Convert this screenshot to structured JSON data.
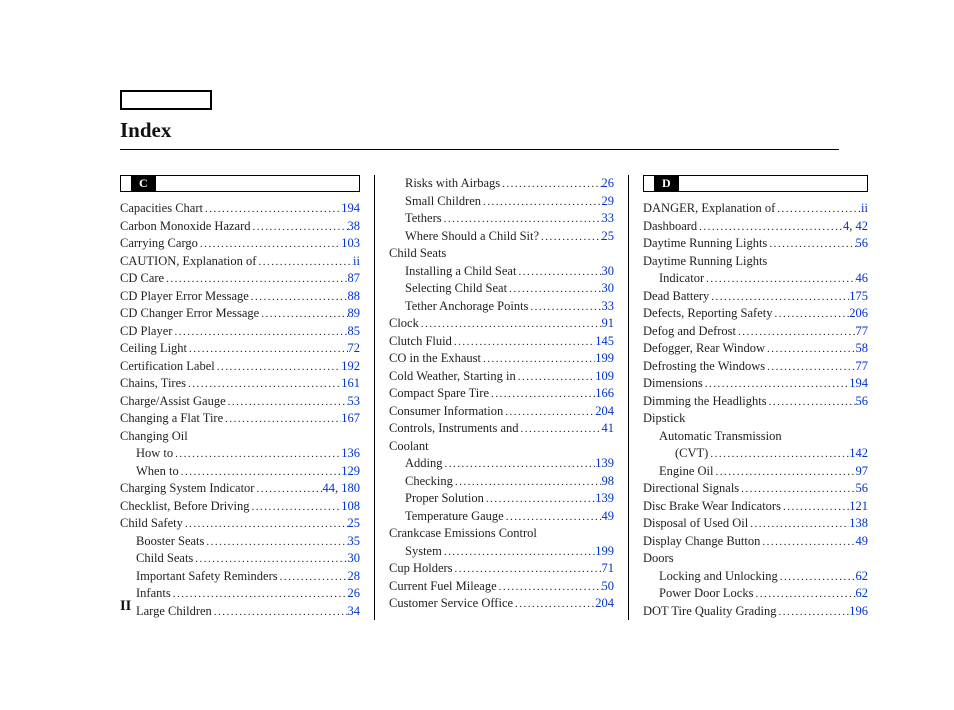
{
  "title": "Index",
  "page_number": "II",
  "sections": {
    "C": {
      "letter": "C"
    },
    "D": {
      "letter": "D"
    }
  },
  "col1": [
    {
      "type": "section",
      "letter": "C"
    },
    {
      "label": "Capacities Chart",
      "pages": [
        "194"
      ],
      "indent": 0
    },
    {
      "label": "Carbon Monoxide Hazard",
      "pages": [
        "38"
      ],
      "indent": 0
    },
    {
      "label": "Carrying Cargo",
      "pages": [
        "103"
      ],
      "indent": 0
    },
    {
      "label": "CAUTION, Explanation of",
      "pages": [
        "ii"
      ],
      "indent": 0
    },
    {
      "label": "CD Care",
      "pages": [
        "87"
      ],
      "indent": 0
    },
    {
      "label": "CD Player Error Message",
      "pages": [
        "88"
      ],
      "indent": 0
    },
    {
      "label": "CD Changer Error Message",
      "pages": [
        "89"
      ],
      "indent": 0
    },
    {
      "label": "CD Player",
      "pages": [
        "85"
      ],
      "indent": 0
    },
    {
      "label": "Ceiling Light",
      "pages": [
        "72"
      ],
      "indent": 0
    },
    {
      "label": "Certification Label",
      "pages": [
        "192"
      ],
      "indent": 0
    },
    {
      "label": "Chains, Tires",
      "pages": [
        "161"
      ],
      "indent": 0
    },
    {
      "label": "Charge/Assist Gauge",
      "pages": [
        "53"
      ],
      "indent": 0
    },
    {
      "label": "Changing a Flat Tire",
      "pages": [
        "167"
      ],
      "indent": 0
    },
    {
      "label": "Changing Oil",
      "plain": true,
      "indent": 0
    },
    {
      "label": "How to",
      "pages": [
        "136"
      ],
      "indent": 1
    },
    {
      "label": "When to",
      "pages": [
        "129"
      ],
      "indent": 1
    },
    {
      "label": "Charging System Indicator",
      "pages": [
        "44",
        "180"
      ],
      "indent": 0
    },
    {
      "label": "Checklist, Before Driving",
      "pages": [
        "108"
      ],
      "indent": 0
    },
    {
      "label": "Child Safety",
      "pages": [
        "25"
      ],
      "indent": 0
    },
    {
      "label": "Booster Seats",
      "pages": [
        "35"
      ],
      "indent": 1
    },
    {
      "label": "Child Seats",
      "pages": [
        "30"
      ],
      "indent": 1
    },
    {
      "label": "Important Safety Reminders",
      "pages": [
        "28"
      ],
      "indent": 1
    },
    {
      "label": "Infants",
      "pages": [
        "26"
      ],
      "indent": 1
    },
    {
      "label": "Large Children",
      "pages": [
        "34"
      ],
      "indent": 1
    }
  ],
  "col2": [
    {
      "label": "Risks with Airbags",
      "pages": [
        "26"
      ],
      "indent": 1,
      "topspace": true
    },
    {
      "label": "Small Children",
      "pages": [
        "29"
      ],
      "indent": 1
    },
    {
      "label": "Tethers",
      "pages": [
        "33"
      ],
      "indent": 1
    },
    {
      "label": "Where Should a Child Sit?",
      "pages": [
        "25"
      ],
      "indent": 1
    },
    {
      "label": "Child Seats",
      "plain": true,
      "indent": 0
    },
    {
      "label": "Installing a Child Seat",
      "pages": [
        "30"
      ],
      "indent": 1
    },
    {
      "label": "Selecting Child Seat",
      "pages": [
        "30"
      ],
      "indent": 1
    },
    {
      "label": "Tether Anchorage Points",
      "pages": [
        "33"
      ],
      "indent": 1
    },
    {
      "label": "Clock",
      "pages": [
        "91"
      ],
      "indent": 0
    },
    {
      "label": "Clutch Fluid",
      "pages": [
        "145"
      ],
      "indent": 0
    },
    {
      "label": "CO in the Exhaust",
      "pages": [
        "199"
      ],
      "indent": 0
    },
    {
      "label": "Cold Weather, Starting in",
      "pages": [
        "109"
      ],
      "indent": 0
    },
    {
      "label": "Compact Spare Tire",
      "pages": [
        "166"
      ],
      "indent": 0
    },
    {
      "label": "Consumer Information",
      "pages": [
        "204"
      ],
      "indent": 0
    },
    {
      "label": "Controls, Instruments and",
      "pages": [
        "41"
      ],
      "indent": 0
    },
    {
      "label": "Coolant",
      "plain": true,
      "indent": 0
    },
    {
      "label": "Adding",
      "pages": [
        "139"
      ],
      "indent": 1
    },
    {
      "label": "Checking",
      "pages": [
        "98"
      ],
      "indent": 1
    },
    {
      "label": "Proper Solution",
      "pages": [
        "139"
      ],
      "indent": 1
    },
    {
      "label": "Temperature Gauge",
      "pages": [
        "49"
      ],
      "indent": 1
    },
    {
      "label": "Crankcase Emissions Control",
      "plain": true,
      "indent": 0
    },
    {
      "label": "System",
      "pages": [
        "199"
      ],
      "indent": 1
    },
    {
      "label": "Cup Holders",
      "pages": [
        "71"
      ],
      "indent": 0
    },
    {
      "label": "Current Fuel Mileage",
      "pages": [
        "50"
      ],
      "indent": 0
    },
    {
      "label": "Customer Service Office",
      "pages": [
        "204"
      ],
      "indent": 0
    }
  ],
  "col3": [
    {
      "type": "section",
      "letter": "D"
    },
    {
      "label": "DANGER, Explanation of",
      "pages": [
        "ii"
      ],
      "indent": 0
    },
    {
      "label": "Dashboard",
      "pages": [
        "4",
        "42"
      ],
      "indent": 0
    },
    {
      "label": "Daytime Running Lights",
      "pages": [
        "56"
      ],
      "indent": 0
    },
    {
      "label": "Daytime Running Lights",
      "plain": true,
      "indent": 0
    },
    {
      "label": "Indicator",
      "pages": [
        "46"
      ],
      "indent": 1
    },
    {
      "label": "Dead Battery",
      "pages": [
        "175"
      ],
      "indent": 0
    },
    {
      "label": "Defects, Reporting Safety",
      "pages": [
        "206"
      ],
      "indent": 0
    },
    {
      "label": "Defog and Defrost",
      "pages": [
        "77"
      ],
      "indent": 0
    },
    {
      "label": "Defogger, Rear Window",
      "pages": [
        "58"
      ],
      "indent": 0
    },
    {
      "label": "Defrosting the Windows",
      "pages": [
        "77"
      ],
      "indent": 0
    },
    {
      "label": "Dimensions",
      "pages": [
        "194"
      ],
      "indent": 0
    },
    {
      "label": "Dimming the Headlights",
      "pages": [
        "56"
      ],
      "indent": 0
    },
    {
      "label": "Dipstick",
      "plain": true,
      "indent": 0
    },
    {
      "label": "Automatic Transmission",
      "plain": true,
      "indent": 1
    },
    {
      "label": "(CVT)",
      "pages": [
        "142"
      ],
      "indent": 2
    },
    {
      "label": "Engine Oil",
      "pages": [
        "97"
      ],
      "indent": 1
    },
    {
      "label": "Directional Signals",
      "pages": [
        "56"
      ],
      "indent": 0
    },
    {
      "label": "Disc Brake Wear Indicators",
      "pages": [
        "121"
      ],
      "indent": 0
    },
    {
      "label": "Disposal of Used Oil",
      "pages": [
        "138"
      ],
      "indent": 0
    },
    {
      "label": "Display Change Button",
      "pages": [
        "49"
      ],
      "indent": 0
    },
    {
      "label": "Doors",
      "plain": true,
      "indent": 0
    },
    {
      "label": "Locking and Unlocking",
      "pages": [
        "62"
      ],
      "indent": 1
    },
    {
      "label": "Power Door Locks",
      "pages": [
        "62"
      ],
      "indent": 1
    },
    {
      "label": "DOT Tire Quality Grading",
      "pages": [
        "196"
      ],
      "indent": 0
    }
  ]
}
